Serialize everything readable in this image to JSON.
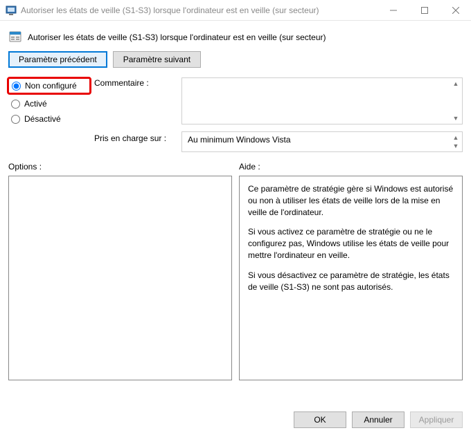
{
  "window": {
    "title": "Autoriser les états de veille (S1-S3) lorsque l'ordinateur est en veille (sur secteur)"
  },
  "heading": "Autoriser les états de veille (S1-S3) lorsque l'ordinateur est en veille (sur secteur)",
  "nav": {
    "prev": "Paramètre précédent",
    "next": "Paramètre suivant"
  },
  "config": {
    "not_configured": "Non configuré",
    "enabled": "Activé",
    "disabled": "Désactivé",
    "comment_label": "Commentaire :",
    "comment_value": "",
    "supported_label": "Pris en charge sur :",
    "supported_value": "Au minimum Windows Vista"
  },
  "panels": {
    "options_label": "Options :",
    "help_label": "Aide :",
    "help_p1": "Ce paramètre de stratégie gère si Windows est autorisé ou non à utiliser les états de veille lors de la mise en veille de l'ordinateur.",
    "help_p2": "Si vous activez ce paramètre de stratégie ou ne le configurez pas, Windows utilise les états de veille pour mettre l'ordinateur en veille.",
    "help_p3": "Si vous désactivez ce paramètre de stratégie, les états de veille (S1-S3) ne sont pas autorisés."
  },
  "footer": {
    "ok": "OK",
    "cancel": "Annuler",
    "apply": "Appliquer"
  }
}
